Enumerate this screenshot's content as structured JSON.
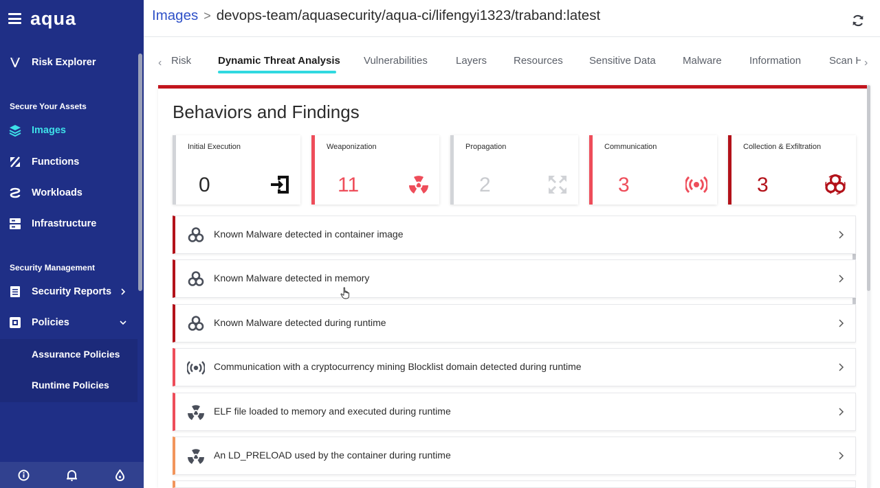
{
  "colors": {
    "sidebar_bg": "#1f2f86",
    "active_accent": "#3ee0e8",
    "critical": "#b3121a",
    "high": "#ee4d5a",
    "medium": "#f2955b",
    "link": "#2f51c8"
  },
  "app": {
    "logo": "aqua"
  },
  "sidebar": {
    "risk_explorer": "Risk Explorer",
    "section_assets": "Secure Your Assets",
    "images": "Images",
    "functions": "Functions",
    "workloads": "Workloads",
    "infrastructure": "Infrastructure",
    "section_security": "Security Management",
    "security_reports": "Security Reports",
    "policies": "Policies",
    "assurance_policies": "Assurance Policies",
    "runtime_policies": "Runtime Policies"
  },
  "header": {
    "crumb_root": "Images",
    "separator": ">",
    "crumb_path": "devops-team/aquasecurity/aqua-ci/lifengyi1323/traband:latest"
  },
  "tabs": {
    "risk": "Risk",
    "dta": "Dynamic Threat Analysis",
    "vulnerabilities": "Vulnerabilities",
    "layers": "Layers",
    "resources": "Resources",
    "sensitive": "Sensitive Data",
    "malware": "Malware",
    "information": "Information",
    "scan": "Scan H"
  },
  "main": {
    "heading": "Behaviors and Findings",
    "cards": [
      {
        "title": "Initial Execution",
        "count": "0",
        "icon": "entry-icon"
      },
      {
        "title": "Weaponization",
        "count": "11",
        "icon": "radiation-icon"
      },
      {
        "title": "Propagation",
        "count": "2",
        "icon": "expand-arrows-icon"
      },
      {
        "title": "Communication",
        "count": "3",
        "icon": "broadcast-icon"
      },
      {
        "title": "Collection & Exfiltration",
        "count": "3",
        "icon": "biohazard-icon"
      }
    ],
    "findings": [
      {
        "text": "Known Malware detected in container image",
        "icon": "biohazard-icon",
        "severity": "critical"
      },
      {
        "text": "Known Malware detected in memory",
        "icon": "biohazard-icon",
        "severity": "critical"
      },
      {
        "text": "Known Malware detected during runtime",
        "icon": "biohazard-icon",
        "severity": "critical"
      },
      {
        "text": "Communication with a cryptocurrency mining Blocklist domain detected during runtime",
        "icon": "broadcast-icon",
        "severity": "high"
      },
      {
        "text": "ELF file loaded to memory and executed during runtime",
        "icon": "radiation-icon",
        "severity": "high"
      },
      {
        "text": "An LD_PRELOAD used by the container during runtime",
        "icon": "radiation-icon",
        "severity": "medium"
      }
    ]
  }
}
